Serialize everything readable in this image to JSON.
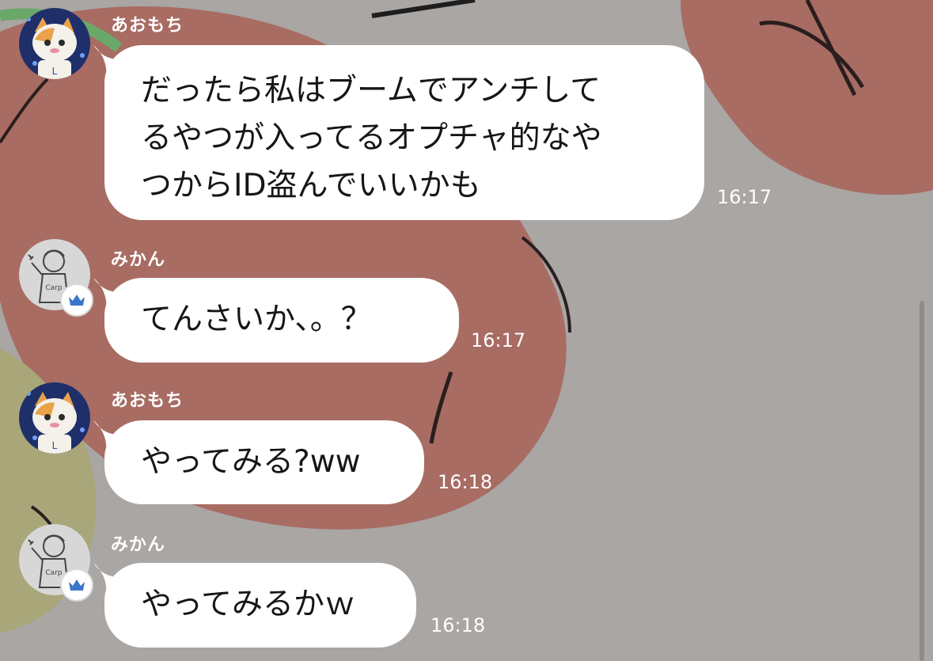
{
  "messages": [
    {
      "sender": "あおもち",
      "lines": [
        "だったら私はブームでアンチして",
        "るやつが入ってるオプチャ的なや",
        "つからID盗んでいいかも"
      ],
      "time": "16:17",
      "avatar": "cat-mascot-avatar"
    },
    {
      "sender": "みかん",
      "lines": [
        "てんさいか、。？"
      ],
      "time": "16:17",
      "avatar": "sketch-avatar",
      "badge": "crown-icon"
    },
    {
      "sender": "あおもち",
      "lines": [
        "やってみる?ww"
      ],
      "time": "16:18",
      "avatar": "cat-mascot-avatar"
    },
    {
      "sender": "みかん",
      "lines": [
        "やってみるかｗ"
      ],
      "time": "16:18",
      "avatar": "sketch-avatar",
      "badge": "crown-icon"
    }
  ],
  "colors": {
    "bubble": "#ffffff",
    "badge_crown": "#3b77c9",
    "sender_text": "#ffffff"
  }
}
